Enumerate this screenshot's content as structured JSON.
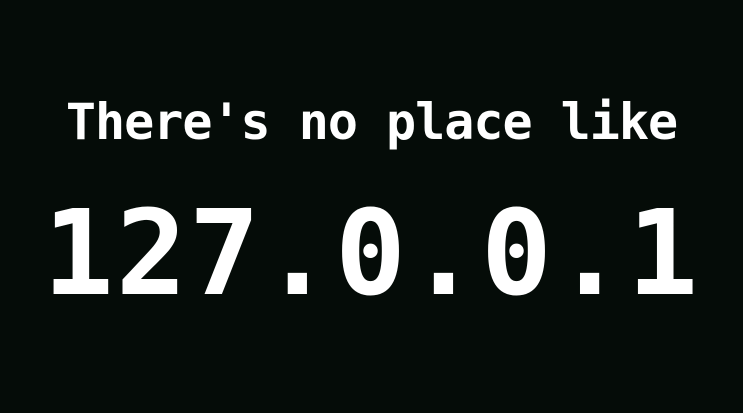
{
  "background_color": "#050c08",
  "text_color": "#ffffff",
  "message": {
    "tagline": "There's no place like",
    "address": "127.0.0.1"
  }
}
